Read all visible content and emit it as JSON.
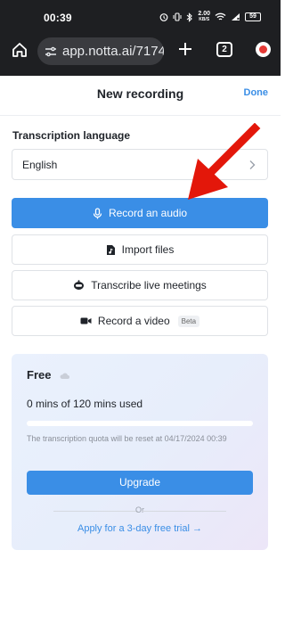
{
  "status_bar": {
    "time": "00:39",
    "network_speed_value": "2.00",
    "network_speed_unit": "KB/S",
    "battery": "59"
  },
  "browser": {
    "url": "app.notta.ai/7174",
    "tab_count": "2"
  },
  "header": {
    "title": "New recording",
    "done_label": "Done"
  },
  "transcription": {
    "label": "Transcription language",
    "selected_language": "English"
  },
  "actions": {
    "record_audio": "Record an audio",
    "import_files": "Import files",
    "transcribe_meetings": "Transcribe live meetings",
    "record_video": "Record a video",
    "beta_badge": "Beta"
  },
  "plan": {
    "name": "Free",
    "usage_text": "0 mins of 120 mins used",
    "usage_fraction": 0.0,
    "reset_note": "The transcription quota will be reset at 04/17/2024 00:39",
    "upgrade_label": "Upgrade",
    "or_label": "Or",
    "trial_label": "Apply for a 3-day free trial →"
  },
  "colors": {
    "accent": "#3a8ee6",
    "annotation_arrow": "#e3170a",
    "browser_bar": "#1e1f22"
  }
}
